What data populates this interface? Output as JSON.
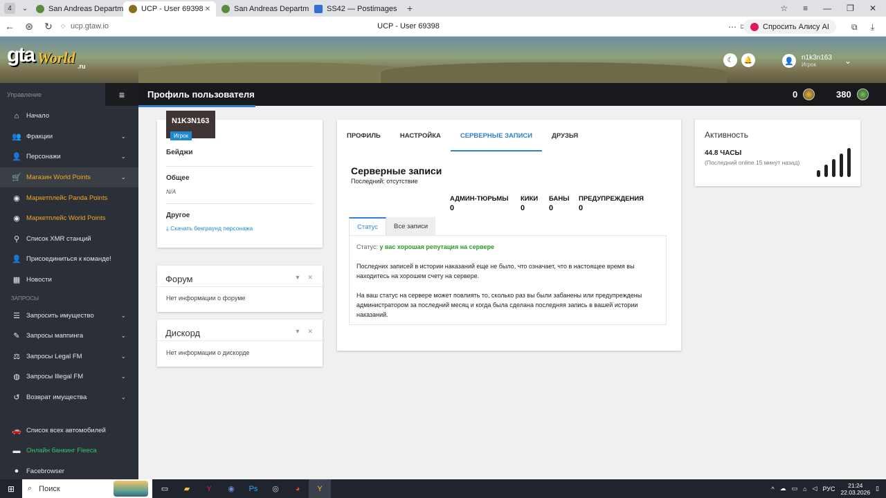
{
  "browser": {
    "tab_count": "4",
    "tabs": [
      {
        "title": "San Andreas Department o",
        "color": "#5a8a3c"
      },
      {
        "title": "UCP - User 69398",
        "color": "#8a6d1f"
      },
      {
        "title": "San Andreas Department o",
        "color": "#5a8a3c"
      },
      {
        "title": "SS42 — Postimages",
        "color": "#2f6fd6"
      }
    ],
    "url": "ucp.gtaw.io",
    "page_title": "UCP - User 69398",
    "alice_label": "Спросить Алису AI"
  },
  "header": {
    "logo_gta": "gta",
    "logo_world": "World",
    "logo_ru": ".ru",
    "user_name": "n1k3n163",
    "user_role": "Игрок"
  },
  "sidebar": {
    "section_manage": "Управление",
    "items": [
      {
        "label": "Начало",
        "icon": "home-icon",
        "glyph": "⌂",
        "chev": ""
      },
      {
        "label": "Фракции",
        "icon": "users-icon",
        "glyph": "👥",
        "chev": "⌄"
      },
      {
        "label": "Персонажи",
        "icon": "user-icon",
        "glyph": "👤",
        "chev": "⌄"
      },
      {
        "label": "Магазин World Points",
        "icon": "cart-icon",
        "glyph": "🛒",
        "chev": "⌄"
      },
      {
        "label": "Маркетплейс Panda Points",
        "icon": "coins-icon",
        "glyph": "◉",
        "chev": ""
      },
      {
        "label": "Маркетплейс World Points",
        "icon": "coins-icon",
        "glyph": "◉",
        "chev": ""
      },
      {
        "label": "Список XMR станций",
        "icon": "antenna-icon",
        "glyph": "⚲",
        "chev": ""
      },
      {
        "label": "Присоединиться к команде!",
        "icon": "user-plus-icon",
        "glyph": "👤",
        "chev": ""
      },
      {
        "label": "Новости",
        "icon": "news-icon",
        "glyph": "▦",
        "chev": ""
      }
    ],
    "section_requests": "ЗАПРОСЫ",
    "request_items": [
      {
        "label": "Запросить имущество",
        "icon": "list-icon",
        "glyph": "☰",
        "chev": "⌄"
      },
      {
        "label": "Запросы маппинга",
        "icon": "brush-icon",
        "glyph": "✎",
        "chev": "⌄"
      },
      {
        "label": "Запросы Legal FM",
        "icon": "scale-icon",
        "glyph": "⚖",
        "chev": "⌄"
      },
      {
        "label": "Запросы Illegal FM",
        "icon": "mask-icon",
        "glyph": "◍",
        "chev": "⌄"
      },
      {
        "label": "Возврат имущества",
        "icon": "undo-icon",
        "glyph": "↺",
        "chev": "⌄"
      }
    ],
    "bottom_items": [
      {
        "label": "Список всех автомобилей",
        "icon": "car-icon",
        "glyph": "🚗",
        "chev": ""
      },
      {
        "label": "Онлайн банкинг Fleeca",
        "icon": "money-icon",
        "glyph": "▬",
        "chev": ""
      },
      {
        "label": "Facebrowser",
        "icon": "globe-icon",
        "glyph": "●",
        "chev": ""
      }
    ]
  },
  "page_header": {
    "title": "Профиль пользователя",
    "stat1": "0",
    "stat2": "380"
  },
  "profile": {
    "name": "N1K3N163",
    "role": "Игрок",
    "badges_label": "Бейджи",
    "general_label": "Общее",
    "general_value": "N/A",
    "other_label": "Другое",
    "download_link": "Скачать бекграунд персонажа"
  },
  "forum": {
    "title": "Форум",
    "body": "Нет информации о форуме"
  },
  "discord": {
    "title": "Дискорд",
    "body": "Нет информации о дискорде"
  },
  "main_tabs": [
    "ПРОФИЛЬ",
    "НАСТРОЙКА",
    "СЕРВЕРНЫЕ ЗАПИСИ",
    "ДРУЗЬЯ"
  ],
  "records": {
    "title": "Серверные записи",
    "subtitle": "Последний: отсутствие",
    "counters": [
      {
        "label": "АДМИН-ТЮРЬМЫ",
        "value": "0"
      },
      {
        "label": "КИКИ",
        "value": "0"
      },
      {
        "label": "БАНЫ",
        "value": "0"
      },
      {
        "label": "ПРЕДУПРЕЖДЕНИЯ",
        "value": "0"
      }
    ],
    "subtabs": [
      "Статус",
      "Все записи"
    ],
    "status_label": "Статус:",
    "status_value": "у вас хорошая репутация на сервере",
    "para1": "Последних записей в истории наказаний еще не было, что означает, что в настоящее время вы находитесь на хорошем счету на сервере.",
    "para2": "На ваш статус на сервере может повлиять то, сколько раз вы были забанены или предупреждены администратором за последний месяц и когда была сделана последняя запись в вашей истории наказаний."
  },
  "activity": {
    "title": "Активность",
    "hours": "44.8 ЧАСЫ",
    "last_online": "(Последний online 15 минут назад)"
  },
  "taskbar": {
    "search_label": "Поиск",
    "lang": "РУС",
    "time": "21:24",
    "date": "22.03.2026"
  }
}
